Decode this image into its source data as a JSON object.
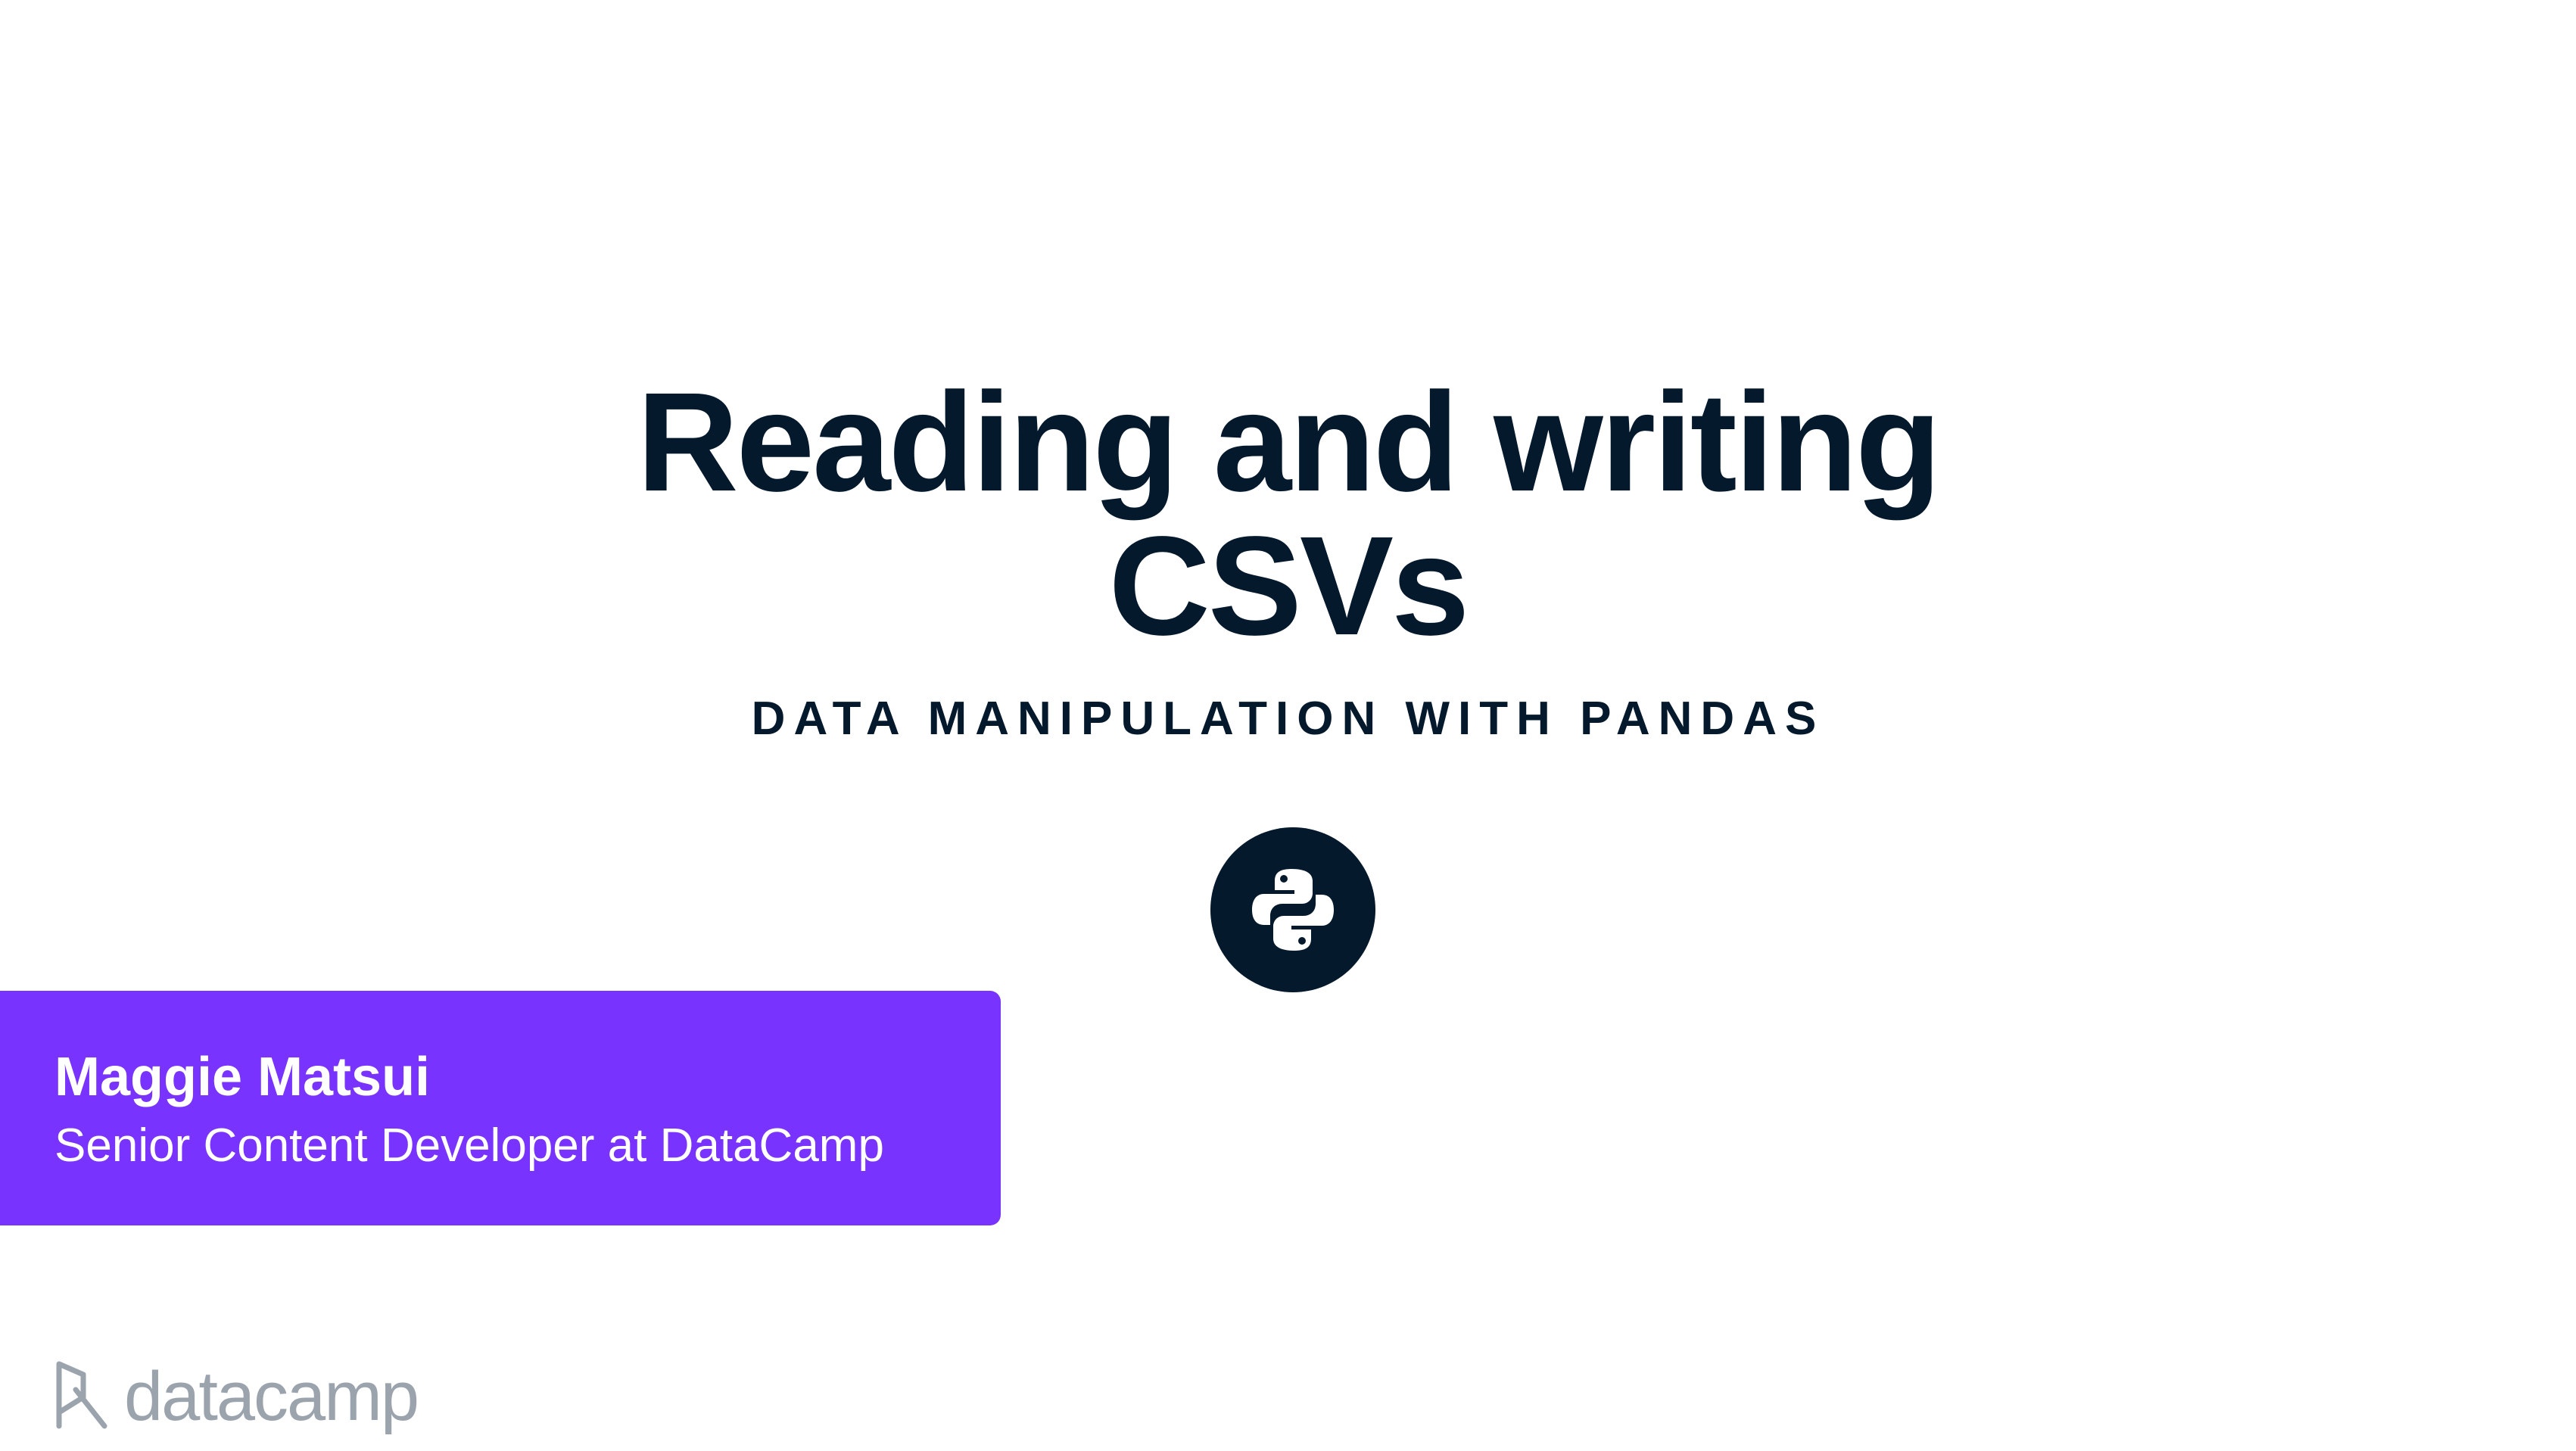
{
  "slide": {
    "title_line1": "Reading and writing",
    "title_line2": "CSVs",
    "course": "DATA MANIPULATION WITH PANDAS",
    "badge_icon": "python-logo-icon"
  },
  "instructor": {
    "name": "Maggie Matsui",
    "role": "Senior Content Developer at DataCamp"
  },
  "brand": {
    "logo_icon": "datacamp-logo-icon",
    "wordmark": "datacamp"
  },
  "colors": {
    "title": "#05192d",
    "card": "#7933ff",
    "logo": "#9ba4ad"
  }
}
